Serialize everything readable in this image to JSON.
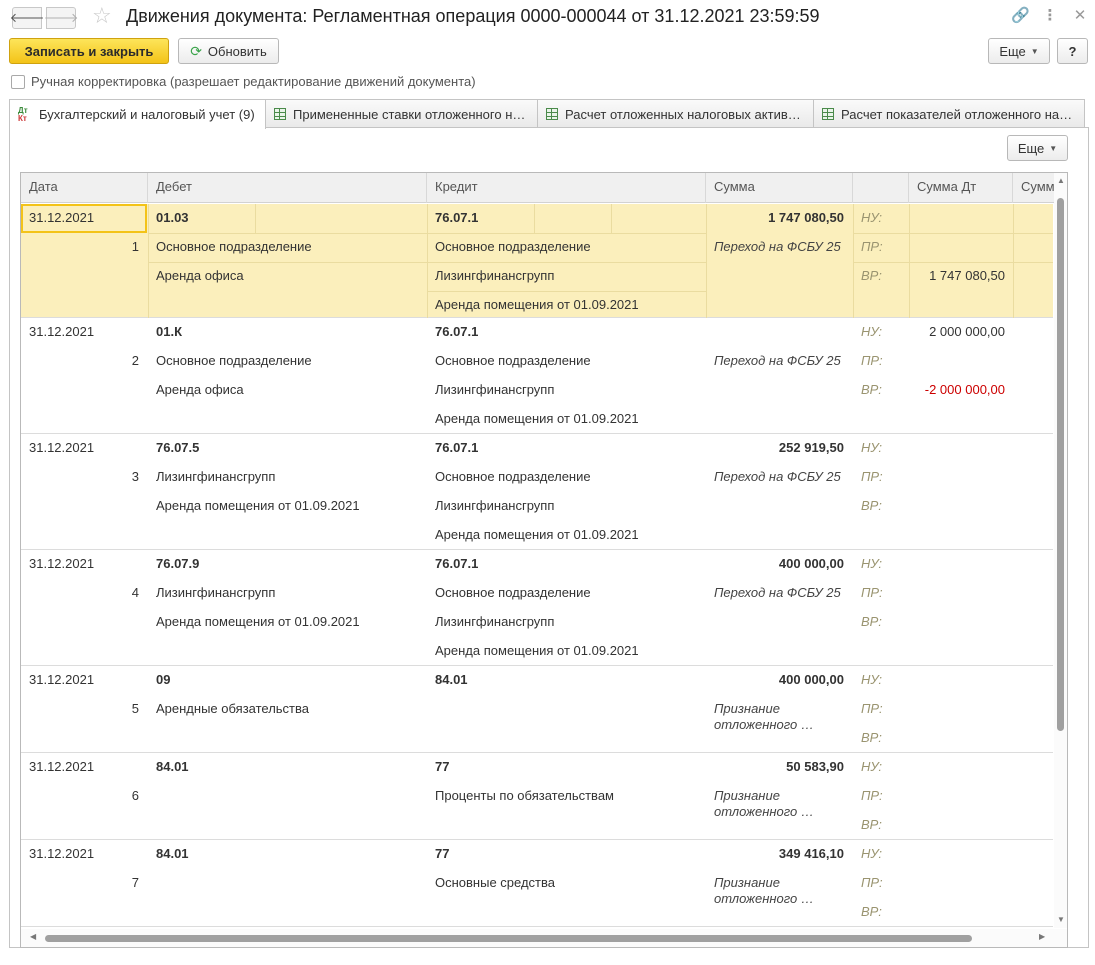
{
  "window": {
    "title": "Движения документа: Регламентная операция 0000-000044 от 31.12.2021 23:59:59",
    "back_glyph": "🡐",
    "forward_glyph": "🡒",
    "star_glyph": "☆",
    "link_glyph": "🔗",
    "menu_glyph": "⋮",
    "close_glyph": "✕"
  },
  "toolbar": {
    "save_close_label": "Записать и закрыть",
    "refresh_label": "Обновить",
    "refresh_glyph": "⟳",
    "more_label": "Еще",
    "help_label": "?"
  },
  "manual_checkbox_label": "Ручная корректировка (разрешает редактирование движений документа)",
  "tabs": [
    {
      "label": "Бухгалтерский и налоговый учет (9)",
      "icon": "dt-kt-icon"
    },
    {
      "label": "Примененные ставки отложенного н…",
      "icon": "table-icon"
    },
    {
      "label": "Расчет отложенных налоговых актив…",
      "icon": "table-icon"
    },
    {
      "label": "Расчет показателей отложенного на…",
      "icon": "table-icon"
    }
  ],
  "dtkt_top": "Дт",
  "dtkt_bottom": "Кт",
  "tab_more_label": "Еще",
  "columns": {
    "date": "Дата",
    "debit": "Дебет",
    "credit": "Кредит",
    "sum": "Сумма",
    "sum_dt": "Сумма Дт",
    "sum_kt": "Сумм"
  },
  "entries": [
    {
      "date": "31.12.2021",
      "num": "1",
      "debit": [
        "01.03",
        "Основное подразделение",
        "Аренда офиса"
      ],
      "credit": [
        "76.07.1",
        "Основное подразделение",
        "Лизингфинансгрупп",
        "Аренда помещения от 01.09.2021"
      ],
      "sum": "1 747 080,50",
      "content": "Переход на ФСБУ 25",
      "labels": [
        "НУ:",
        "ПР:",
        "ВР:"
      ],
      "sum_dt": [
        "",
        "",
        "1 747 080,50"
      ]
    },
    {
      "date": "31.12.2021",
      "num": "2",
      "debit": [
        "01.К",
        "Основное подразделение",
        "Аренда офиса"
      ],
      "credit": [
        "76.07.1",
        "Основное подразделение",
        "Лизингфинансгрупп",
        "Аренда помещения от 01.09.2021"
      ],
      "sum": "",
      "content": "Переход на ФСБУ 25",
      "labels": [
        "НУ:",
        "ПР:",
        "ВР:"
      ],
      "sum_dt": [
        "2 000 000,00",
        "",
        "-2 000 000,00"
      ]
    },
    {
      "date": "31.12.2021",
      "num": "3",
      "debit": [
        "76.07.5",
        "Лизингфинансгрупп",
        "Аренда помещения от 01.09.2021"
      ],
      "credit": [
        "76.07.1",
        "Основное подразделение",
        "Лизингфинансгрупп",
        "Аренда помещения от 01.09.2021"
      ],
      "sum": "252 919,50",
      "content": "Переход на ФСБУ 25",
      "labels": [
        "НУ:",
        "ПР:",
        "ВР:"
      ],
      "sum_dt": [
        "",
        "",
        ""
      ]
    },
    {
      "date": "31.12.2021",
      "num": "4",
      "debit": [
        "76.07.9",
        "Лизингфинансгрупп",
        "Аренда помещения от 01.09.2021"
      ],
      "credit": [
        "76.07.1",
        "Основное подразделение",
        "Лизингфинансгрупп",
        "Аренда помещения от 01.09.2021"
      ],
      "sum": "400 000,00",
      "content": "Переход на ФСБУ 25",
      "labels": [
        "НУ:",
        "ПР:",
        "ВР:"
      ],
      "sum_dt": [
        "",
        "",
        ""
      ]
    },
    {
      "date": "31.12.2021",
      "num": "5",
      "debit": [
        "09",
        "Арендные обязательства"
      ],
      "credit": [
        "84.01"
      ],
      "sum": "400 000,00",
      "content": "Признание отложенного …",
      "labels": [
        "НУ:",
        "ПР:",
        "ВР:"
      ],
      "sum_dt": [
        "",
        "",
        ""
      ]
    },
    {
      "date": "31.12.2021",
      "num": "6",
      "debit": [
        "84.01"
      ],
      "credit": [
        "77",
        "Проценты по обязательствам"
      ],
      "sum": "50 583,90",
      "content": "Признание отложенного …",
      "labels": [
        "НУ:",
        "ПР:",
        "ВР:"
      ],
      "sum_dt": [
        "",
        "",
        ""
      ]
    },
    {
      "date": "31.12.2021",
      "num": "7",
      "debit": [
        "84.01"
      ],
      "credit": [
        "77",
        "Основные средства"
      ],
      "sum": "349 416,10",
      "content": "Признание отложенного …",
      "labels": [
        "НУ:",
        "ПР:",
        "ВР:"
      ],
      "sum_dt": [
        "",
        "",
        ""
      ]
    }
  ],
  "colors": {
    "accent": "#f3c318",
    "selected_row": "#fbefbc",
    "negative": "#cc0000",
    "label": "#9a9470"
  }
}
